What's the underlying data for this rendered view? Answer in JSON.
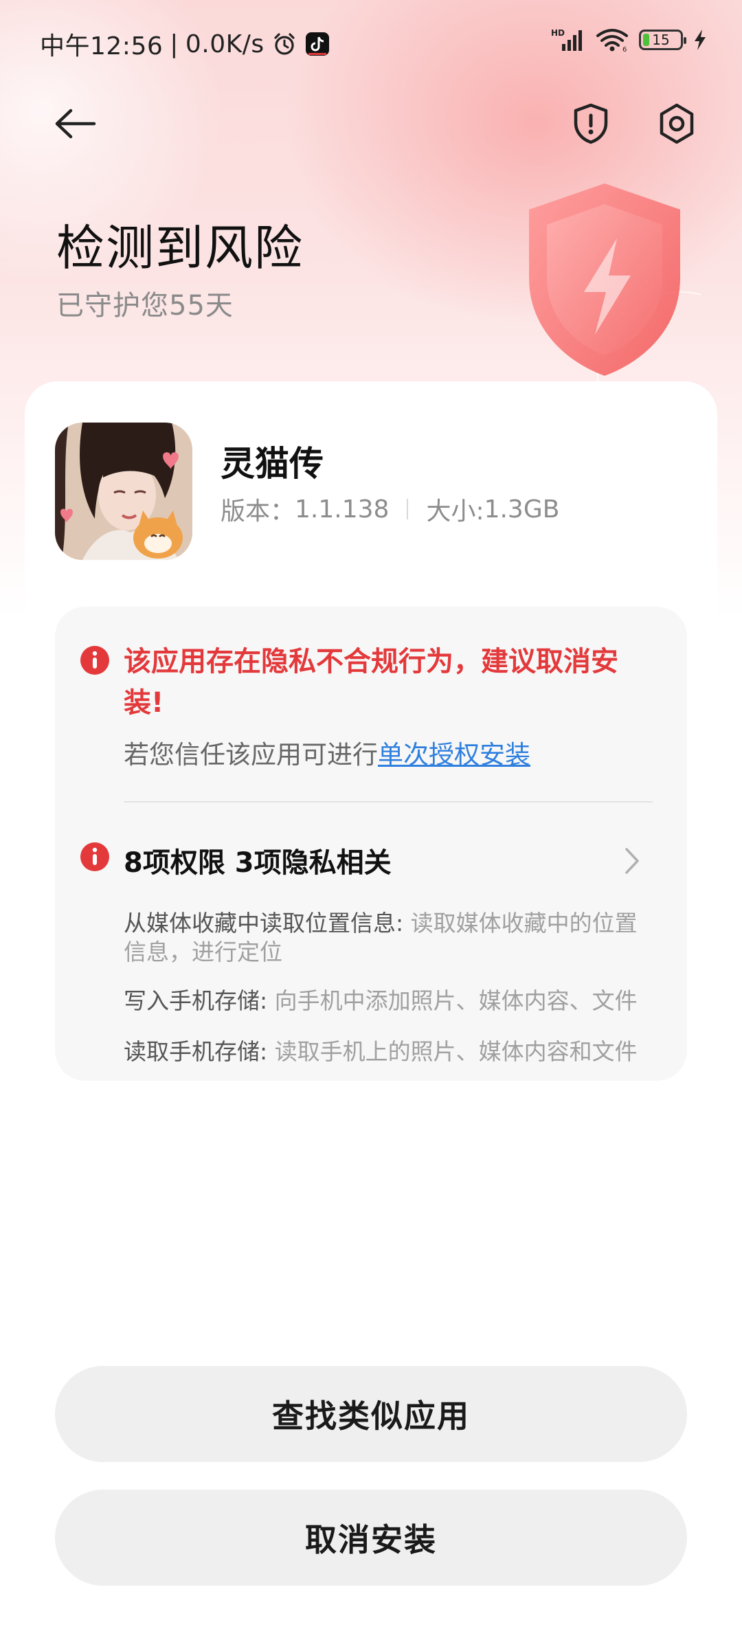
{
  "status_bar": {
    "time": "中午12:56",
    "separator": "|",
    "net_speed": "0.0K/s",
    "network_type": "HD",
    "battery_level": "15",
    "icons": [
      "alarm-icon",
      "tiktok-icon",
      "signal-icon",
      "wifi-icon",
      "battery-icon",
      "charging-icon"
    ]
  },
  "header": {
    "back_icon": "back-arrow-icon",
    "shield_icon": "shield-alert-icon",
    "settings_icon": "gear-icon"
  },
  "hero": {
    "title": "检测到风险",
    "subtitle": "已守护您55天",
    "accent_color": "#f26b6b"
  },
  "app": {
    "name": "灵猫传",
    "version_label": "版本：",
    "version": "1.1.138",
    "size_label": "大小:",
    "size": "1.3GB"
  },
  "risk": {
    "warning": "该应用存在隐私不合规行为，建议取消安装!",
    "trust_prefix": "若您信任该应用可进行",
    "trust_link": "单次授权安装",
    "warning_color": "#e3393b",
    "link_color": "#2f7fde"
  },
  "permissions": {
    "summary": "8项权限 3项隐私相关",
    "items": [
      {
        "name": "从媒体收藏中读取位置信息: ",
        "desc": "读取媒体收藏中的位置信息，进行定位"
      },
      {
        "name": "写入手机存储: ",
        "desc": "向手机中添加照片、媒体内容、文件"
      },
      {
        "name": "读取手机存储: ",
        "desc": "读取手机上的照片、媒体内容和文件"
      }
    ]
  },
  "actions": {
    "find_similar": "查找类似应用",
    "cancel_install": "取消安装"
  }
}
